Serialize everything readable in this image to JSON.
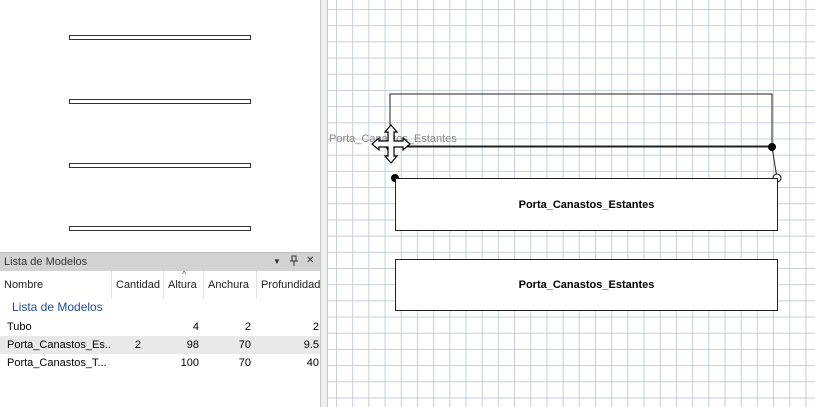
{
  "stencil_preview": {
    "items": [
      "shelf-1",
      "shelf-2",
      "shelf-3",
      "shelf-4"
    ]
  },
  "models_panel": {
    "title": "Lista de Modelos",
    "controls": {
      "dropdown": "▼",
      "pin": "📌",
      "close": "✕"
    },
    "columns": [
      "Nombre",
      "Cantidad",
      "Altura",
      "Anchura",
      "Profundidad"
    ],
    "sort_indicator": "^",
    "group_label": "Lista de Modelos",
    "rows": [
      {
        "nombre": "Tubo",
        "cantidad": "",
        "altura": "4",
        "anchura": "2",
        "profundidad": "2"
      },
      {
        "nombre": "Porta_Canastos_Es...",
        "cantidad": "2",
        "altura": "98",
        "anchura": "70",
        "profundidad": "9.5"
      },
      {
        "nombre": "Porta_Canastos_T...",
        "cantidad": "",
        "altura": "100",
        "anchura": "70",
        "profundidad": "40"
      }
    ]
  },
  "canvas": {
    "ghost_label": "Porta_Canastos_Estantes",
    "shapes": [
      {
        "label": "Porta_Canastos_Estantes"
      },
      {
        "label": "Porta_Canastos_Estantes"
      }
    ]
  }
}
